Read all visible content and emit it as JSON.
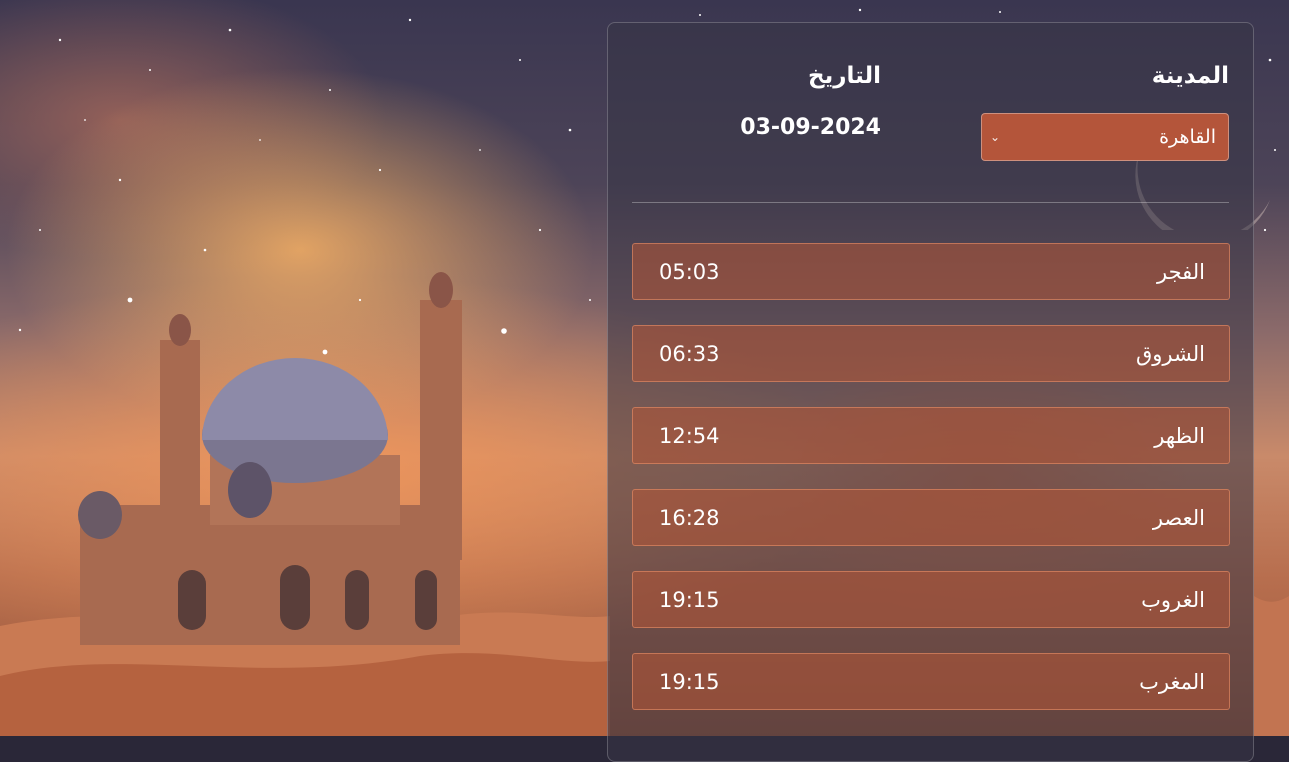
{
  "header": {
    "city_label": "المدينة",
    "date_label": "التاريخ",
    "city_selected": "القاهرة",
    "date_value": "03-09-2024"
  },
  "prayers": [
    {
      "name": "الفجر",
      "time": "05:03"
    },
    {
      "name": "الشروق",
      "time": "06:33"
    },
    {
      "name": "الظهر",
      "time": "12:54"
    },
    {
      "name": "العصر",
      "time": "16:28"
    },
    {
      "name": "الغروب",
      "time": "19:15"
    },
    {
      "name": "المغرب",
      "time": "19:15"
    }
  ],
  "colors": {
    "accent": "#b4553a",
    "panel": "#37344a"
  },
  "icons": {
    "select": "chevron-down-icon"
  }
}
